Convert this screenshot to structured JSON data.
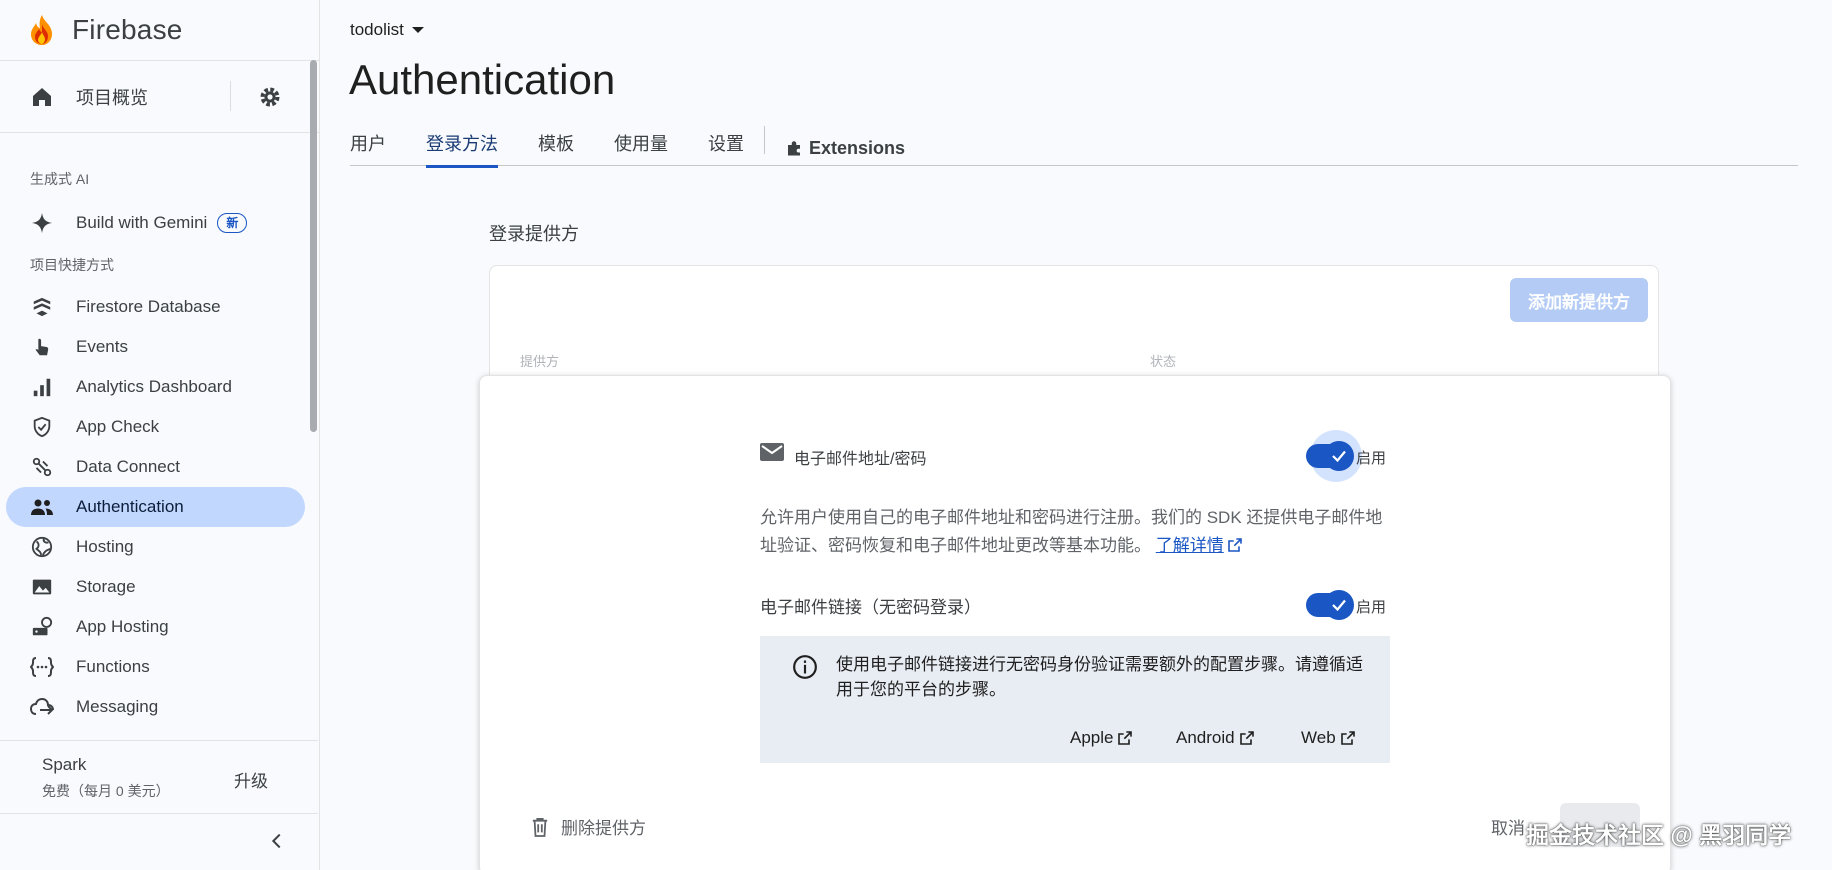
{
  "brand": {
    "name": "Firebase"
  },
  "sidebar": {
    "overview_label": "项目概览",
    "section_ai": "生成式 AI",
    "gemini": {
      "label": "Build with Gemini",
      "badge": "新"
    },
    "section_shortcuts": "项目快捷方式",
    "items": [
      {
        "label": "Firestore Database",
        "icon": "firestore-icon"
      },
      {
        "label": "Events",
        "icon": "touch-icon"
      },
      {
        "label": "Analytics Dashboard",
        "icon": "bar-chart-icon"
      },
      {
        "label": "App Check",
        "icon": "shield-check-icon"
      },
      {
        "label": "Data Connect",
        "icon": "data-connect-icon"
      },
      {
        "label": "Authentication",
        "icon": "people-icon",
        "active": true
      },
      {
        "label": "Hosting",
        "icon": "globe-icon"
      },
      {
        "label": "Storage",
        "icon": "image-icon"
      },
      {
        "label": "App Hosting",
        "icon": "app-hosting-icon"
      },
      {
        "label": "Functions",
        "icon": "functions-icon"
      },
      {
        "label": "Messaging",
        "icon": "cloud-send-icon"
      }
    ],
    "plan": {
      "name": "Spark",
      "desc": "免费（每月 0 美元）",
      "upgrade": "升级"
    }
  },
  "header": {
    "project": "todolist",
    "title": "Authentication",
    "tabs": [
      {
        "label": "用户"
      },
      {
        "label": "登录方法",
        "active": true
      },
      {
        "label": "模板"
      },
      {
        "label": "使用量"
      },
      {
        "label": "设置"
      }
    ],
    "extensions_label": "Extensions"
  },
  "providers": {
    "heading": "登录提供方",
    "add_button": "添加新提供方",
    "col_provider": "提供方",
    "col_status": "状态"
  },
  "panel": {
    "email_title": "电子邮件地址/密码",
    "enabled_label": "启用",
    "description": "允许用户使用自己的电子邮件地址和密码进行注册。我们的 SDK 还提供电子邮件地址验证、密码恢复和电子邮件地址更改等基本功能。",
    "learn_more": "了解详情",
    "link_title": "电子邮件链接（无密码登录）",
    "link_enabled_label": "启用",
    "info_text": "使用电子邮件链接进行无密码身份验证需要额外的配置步骤。请遵循适用于您的平台的步骤。",
    "platforms": [
      "Apple",
      "Android",
      "Web"
    ],
    "delete_label": "删除提供方",
    "cancel_label": "取消"
  },
  "watermark": "掘金技术社区 @ 黑羽同学",
  "colors": {
    "accent": "#1a56c4",
    "active_nav_bg": "#c2d7fe",
    "info_bg": "#e8ecf3"
  }
}
